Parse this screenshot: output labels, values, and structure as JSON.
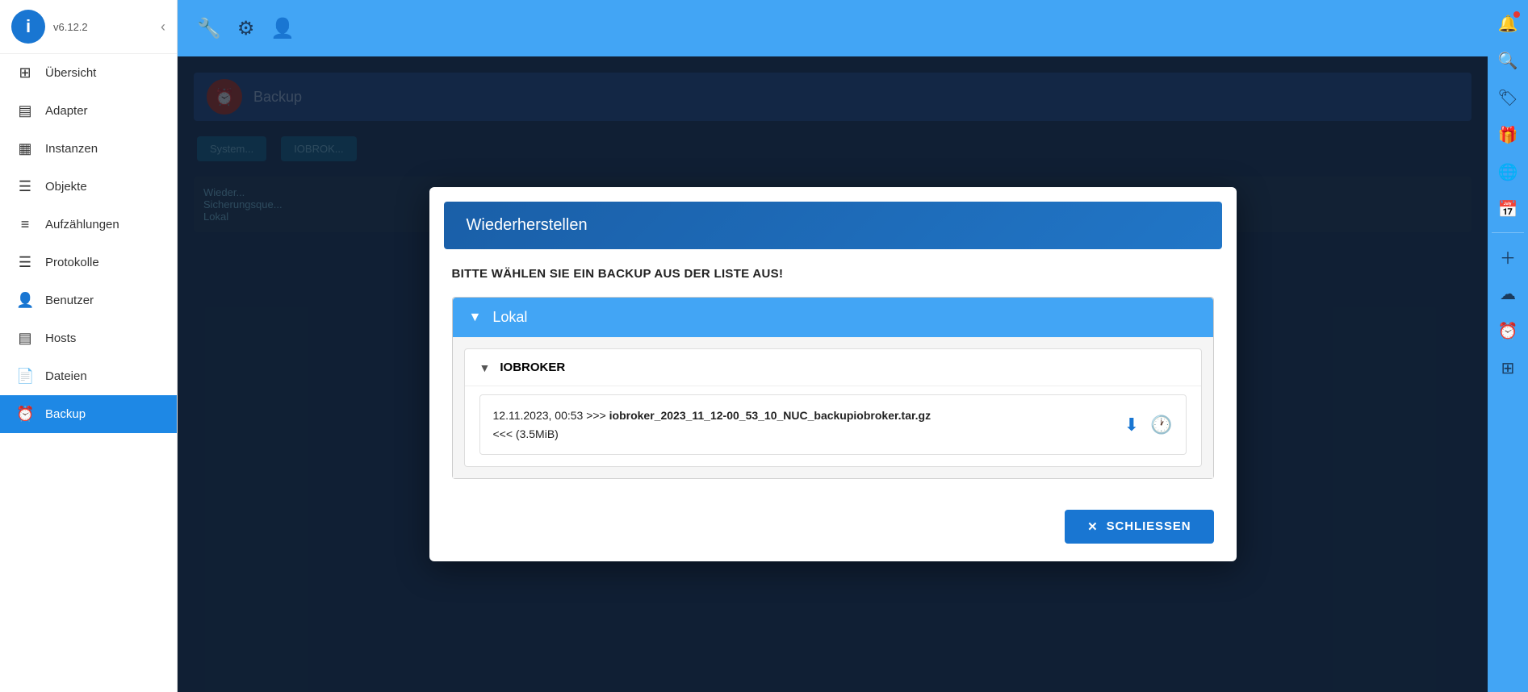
{
  "sidebar": {
    "logo_text": "i",
    "version": "v6.12.2",
    "collapse_icon": "‹",
    "items": [
      {
        "id": "uebersicht",
        "label": "Übersicht",
        "icon": "⊞",
        "active": false
      },
      {
        "id": "adapter",
        "label": "Adapter",
        "icon": "▤",
        "active": false
      },
      {
        "id": "instanzen",
        "label": "Instanzen",
        "icon": "▦",
        "active": false
      },
      {
        "id": "objekte",
        "label": "Objekte",
        "icon": "☰",
        "active": false
      },
      {
        "id": "aufzaehlungen",
        "label": "Aufzählungen",
        "icon": "≡",
        "active": false
      },
      {
        "id": "protokolle",
        "label": "Protokolle",
        "icon": "☰",
        "active": false
      },
      {
        "id": "benutzer",
        "label": "Benutzer",
        "icon": "👤",
        "active": false
      },
      {
        "id": "hosts",
        "label": "Hosts",
        "icon": "▤",
        "active": false
      },
      {
        "id": "dateien",
        "label": "Dateien",
        "icon": "📄",
        "active": false
      },
      {
        "id": "backup",
        "label": "Backup",
        "icon": "⏰",
        "active": true
      }
    ]
  },
  "topbar": {
    "icons": [
      "🔧",
      "⚙",
      "👤"
    ]
  },
  "modal": {
    "title": "Wiederherstellen",
    "instruction": "BITTE WÄHLEN SIE EIN BACKUP AUS DER LISTE AUS!",
    "lokal_section": {
      "label": "Lokal",
      "chevron": "▼",
      "iobroker_section": {
        "label": "IOBROKER",
        "chevron": "▼",
        "entries": [
          {
            "date": "12.11.2023, 00:53",
            "filename": "iobroker_2023_11_12-00_53_10_NUC_backupiobroker.tar.gz",
            "size": "(3.5MiB)",
            "arrow_label": ">>>",
            "back_label": "<<<"
          }
        ]
      }
    },
    "close_button": {
      "label": "SCHLIESSEN",
      "icon": "✕"
    }
  },
  "background": {
    "header_text": "B...",
    "sub_text": "Sy...",
    "btn1": "System...",
    "btn2": "IOBROK...",
    "section_label": "Wieder...",
    "source_label": "Sicherungsque...",
    "source_value": "Lokal"
  },
  "right_bar": {
    "icons": [
      "🔔",
      "🔍",
      "🏷",
      "🎁",
      "🌐",
      "📅",
      "+",
      "☁",
      "⏰",
      "⊞"
    ]
  }
}
